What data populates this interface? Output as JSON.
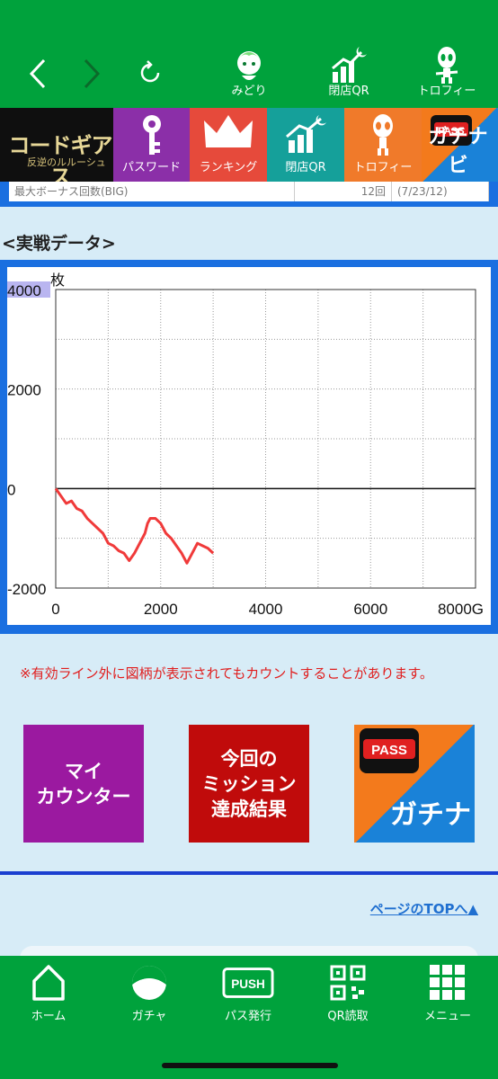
{
  "header": {
    "icons": [
      {
        "label": "みどり",
        "icon": "midori-character-icon"
      },
      {
        "label": "閉店QR",
        "icon": "closing-qr-chart-icon"
      },
      {
        "label": "トロフィー",
        "icon": "trophy-alien-icon"
      }
    ]
  },
  "tiles": {
    "logo_text": "コードギアス",
    "logo_sub": "反逆のルルーシュ",
    "password": "パスワード",
    "ranking": "ランキング",
    "qr": "閉店QR",
    "trophy": "トロフィー",
    "gachinavi_pass": "PASS",
    "gachinavi": "ガチナビ"
  },
  "table_remnant": {
    "col1": "最大ボーナス回数(BIG)",
    "col2": "12回",
    "col3": "(7/23/12)"
  },
  "section_title": "<実戦データ>",
  "chart_data": {
    "type": "line",
    "ylabel": "枚",
    "xlabel_unit": "G",
    "x_ticks": [
      "0",
      "2000",
      "4000",
      "6000",
      "8000G"
    ],
    "y_ticks": [
      "4000",
      "2000",
      "0",
      "-2000"
    ],
    "xlim": [
      0,
      8000
    ],
    "ylim": [
      -2000,
      4000
    ],
    "grid": true,
    "line_color": "#f03a3a",
    "x": [
      0,
      200,
      300,
      400,
      500,
      600,
      700,
      800,
      900,
      1000,
      1100,
      1200,
      1300,
      1400,
      1500,
      1600,
      1700,
      1750,
      1800,
      1900,
      2000,
      2100,
      2200,
      2300,
      2400,
      2500,
      2600,
      2700,
      2800,
      2900,
      3000
    ],
    "y": [
      0,
      -300,
      -250,
      -400,
      -450,
      -600,
      -700,
      -800,
      -900,
      -1100,
      -1150,
      -1250,
      -1300,
      -1450,
      -1300,
      -1100,
      -900,
      -700,
      -600,
      -600,
      -700,
      -900,
      -1000,
      -1150,
      -1300,
      -1500,
      -1300,
      -1100,
      -1150,
      -1200,
      -1300
    ]
  },
  "notice": "※有効ライン外に図柄が表示されてもカウントすることがあります。",
  "buttons": {
    "counter": "マイ\nカウンター",
    "mission": "今回の\nミッション\n達成結果",
    "gachinavi": "ガチナビ"
  },
  "to_top": "ページのTOPへ▲",
  "bottom_nav": [
    {
      "label": "ホーム",
      "icon": "home-icon"
    },
    {
      "label": "ガチャ",
      "icon": "gacha-icon"
    },
    {
      "label": "パス発行",
      "icon": "push-pass-icon"
    },
    {
      "label": "QR読取",
      "icon": "qr-scan-icon"
    },
    {
      "label": "メニュー",
      "icon": "menu-grid-icon"
    }
  ]
}
